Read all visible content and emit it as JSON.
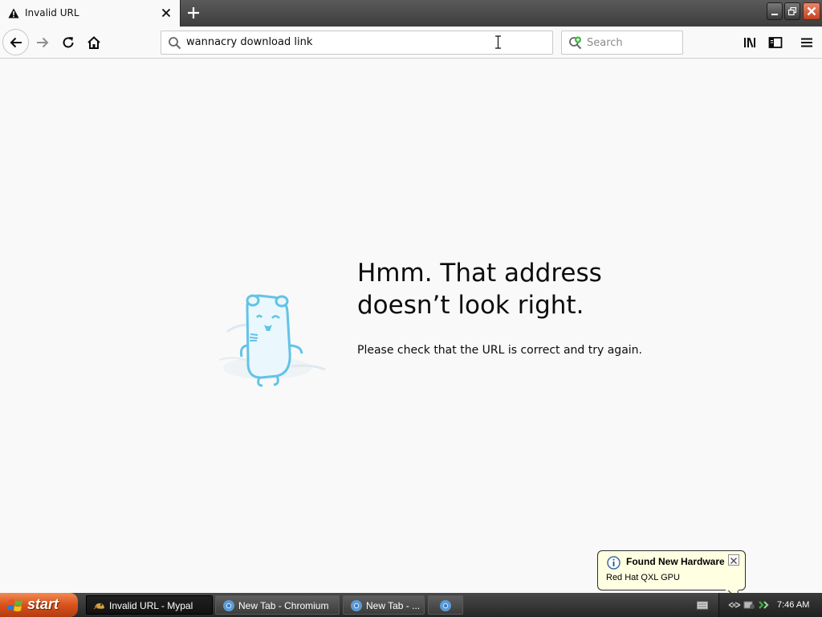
{
  "tab": {
    "title": "Invalid URL"
  },
  "urlbar": {
    "value": "wannacry download link"
  },
  "searchbar": {
    "placeholder": "Search"
  },
  "error": {
    "title": "Hmm. That address doesn’t look right.",
    "description": "Please check that the URL is correct and try again."
  },
  "notification": {
    "title": "Found New Hardware",
    "text": "Red Hat QXL GPU"
  },
  "taskbar": {
    "start_label": "start",
    "tasks": [
      {
        "label": "Invalid URL - Mypal",
        "icon": "mypal-icon"
      },
      {
        "label": "New Tab - Chromium",
        "icon": "chromium-icon"
      },
      {
        "label": "New Tab - ...",
        "icon": "chromium-icon"
      },
      {
        "label": "",
        "icon": "chromium-icon"
      }
    ],
    "clock": "7:46 AM"
  },
  "icons": {
    "tab": [
      "warning-icon",
      "close-icon",
      "plus-icon"
    ],
    "window": [
      "minimize-icon",
      "restore-icon",
      "close-icon"
    ],
    "nav": [
      "back-arrow-icon",
      "forward-arrow-icon",
      "reload-icon",
      "home-icon",
      "search-icon",
      "library-icon",
      "sidebar-icon",
      "hamburger-menu-icon"
    ]
  },
  "colors": {
    "page_background": "#f9f9fa",
    "mascot": "#62c3e6",
    "balloon_background": "#ffffe1",
    "start_button": "#d9521c"
  }
}
